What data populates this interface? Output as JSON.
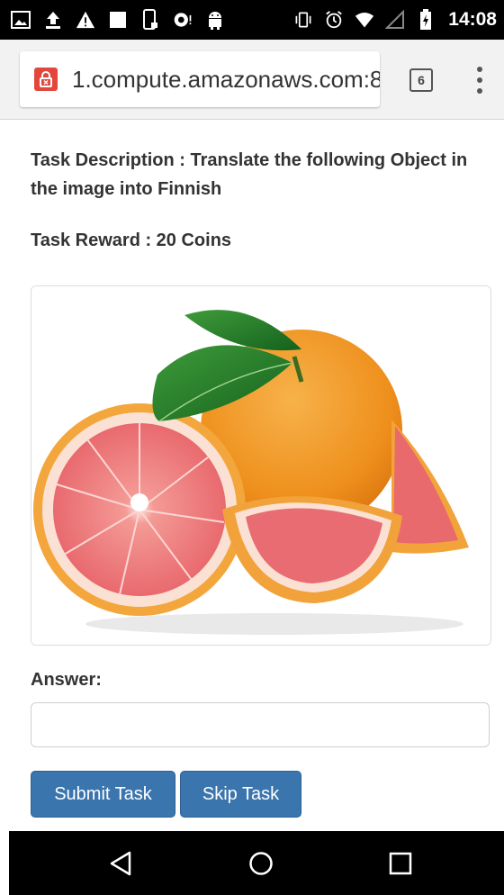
{
  "status_bar": {
    "time": "14:08",
    "left_icons": [
      "image-icon",
      "upload-icon",
      "warning-icon",
      "square-icon",
      "phone-lock-icon",
      "cast-icon",
      "android-icon"
    ],
    "right_icons": [
      "vibrate-icon",
      "alarm-icon",
      "wifi-icon",
      "signal-icon",
      "battery-charging-icon"
    ]
  },
  "browser": {
    "url": "1.compute.amazonaws.com:8",
    "tab_count": "6",
    "lock_icon": "lock-error-icon",
    "menu_icon": "kebab-menu-icon"
  },
  "task": {
    "description": "Task Description : Translate the following Object in the image into Finnish",
    "reward": "Task Reward : 20 Coins",
    "image_alt": "grapefruit"
  },
  "form": {
    "answer_label": "Answer:",
    "answer_value": "",
    "answer_placeholder": "",
    "submit_label": "Submit Task",
    "skip_label": "Skip Task"
  },
  "nav_bar": {
    "icons": [
      "back-icon",
      "home-icon",
      "recents-icon"
    ]
  },
  "colors": {
    "button": "#3a75ad",
    "lock": "#e2463c",
    "status_bar": "#000000"
  }
}
